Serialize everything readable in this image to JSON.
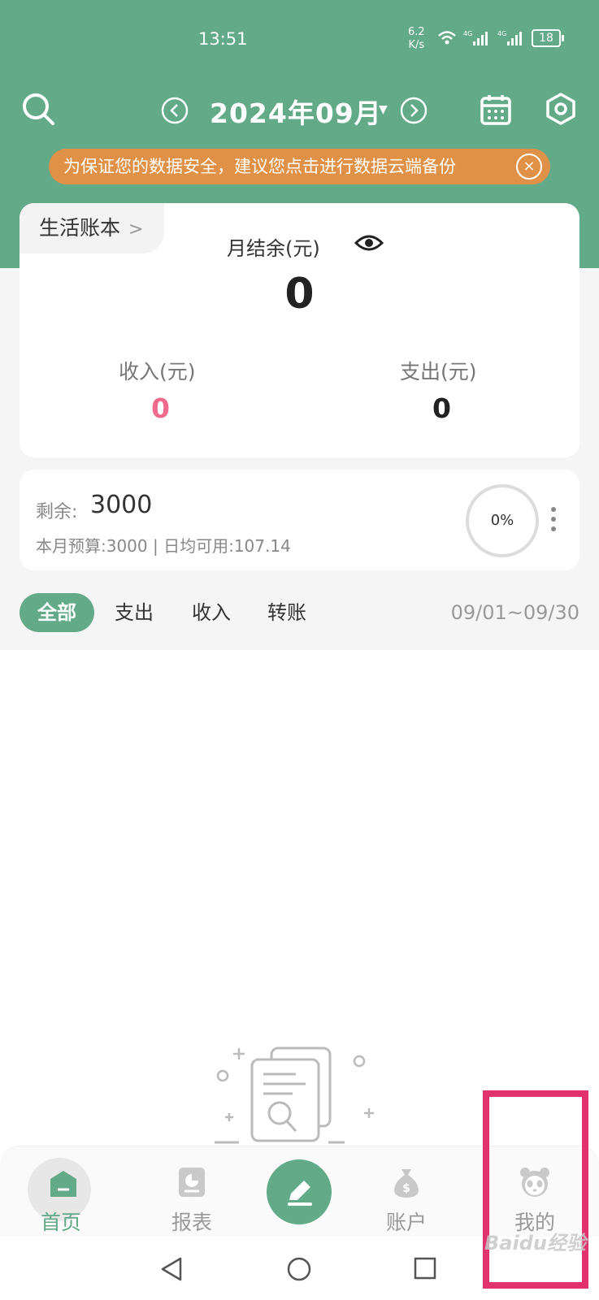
{
  "status_bar": {
    "time": "13:51",
    "net_speed_value": "6.2",
    "net_speed_unit": "K/s",
    "battery": "18",
    "icons": [
      "wifi-icon",
      "signal-4g-icon",
      "signal-4g-icon",
      "battery-icon"
    ]
  },
  "header": {
    "title": "2024年09月",
    "icons": [
      "search-icon",
      "chevron-left-icon",
      "dropdown-caret-icon",
      "chevron-right-icon",
      "calendar-icon",
      "settings-icon"
    ]
  },
  "notice": {
    "text": "为保证您的数据安全，建议您点击进行数据云端备份",
    "close": "×"
  },
  "summary": {
    "book_name": "生活账本",
    "balance_label": "月结余(元)",
    "balance_value": "0",
    "income_label": "收入(元)",
    "income_value": "0",
    "expense_label": "支出(元)",
    "expense_value": "0"
  },
  "budget": {
    "remaining_label": "剩余:",
    "remaining_value": "3000",
    "detail": "本月预算:3000 | 日均可用:107.14",
    "percent": "0%"
  },
  "filters": {
    "tabs": [
      "全部",
      "支出",
      "收入",
      "转账"
    ],
    "active": "全部",
    "date_range": "09/01~09/30"
  },
  "tabbar": {
    "items": [
      {
        "label": "首页",
        "icon": "home-icon"
      },
      {
        "label": "报表",
        "icon": "report-icon"
      },
      {
        "label": "",
        "icon": "pencil-icon"
      },
      {
        "label": "账户",
        "icon": "money-bag-icon"
      },
      {
        "label": "我的",
        "icon": "panda-icon"
      }
    ],
    "active": "首页"
  },
  "system_nav": [
    "back-icon",
    "home-circle-icon",
    "recents-icon"
  ],
  "watermark": "Baidu经验",
  "colors": {
    "primary": "#62aa88",
    "notice": "#e09148",
    "income": "#ef6a8c",
    "highlight": "#e2326e"
  }
}
